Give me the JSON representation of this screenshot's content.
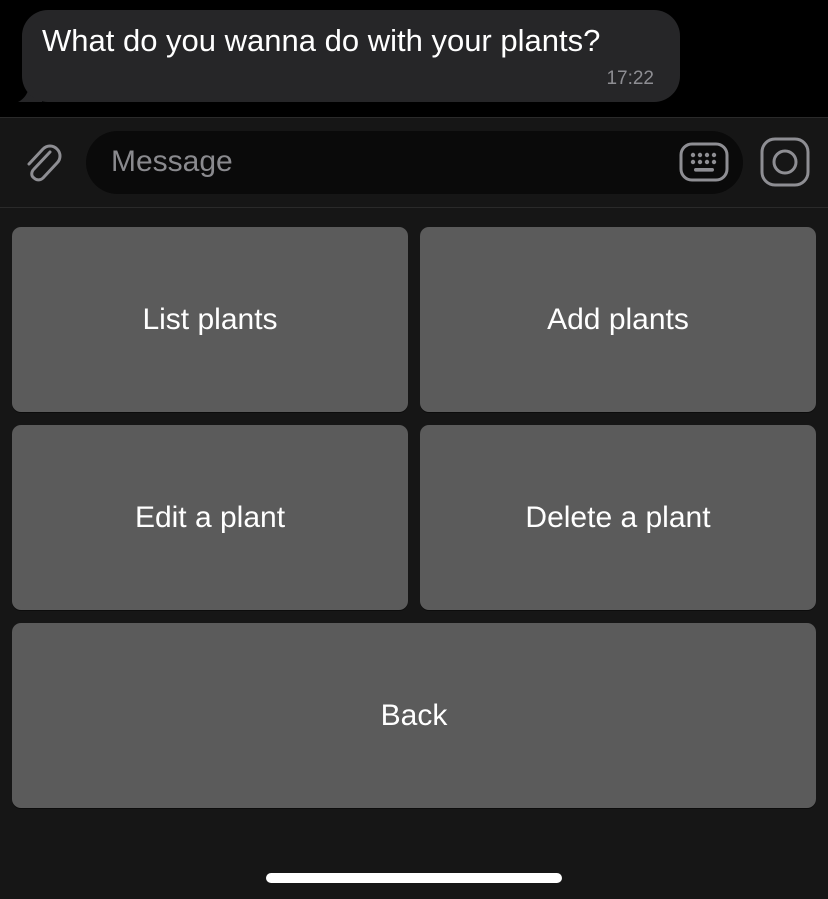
{
  "chat": {
    "message": {
      "text": "What do you wanna do with your plants?",
      "time": "17:22"
    }
  },
  "input_bar": {
    "placeholder": "Message",
    "icons": {
      "attach": "paperclip-icon",
      "keyboard": "keyboard-icon",
      "camera": "camera-icon"
    }
  },
  "reply_keyboard": {
    "buttons": [
      {
        "label": "List plants"
      },
      {
        "label": "Add plants"
      },
      {
        "label": "Edit a plant"
      },
      {
        "label": "Delete a plant"
      },
      {
        "label": "Back"
      }
    ]
  },
  "colors": {
    "background": "#000000",
    "bubble": "#262628",
    "panel": "#161616",
    "button": "#5b5b5b",
    "text": "#ffffff",
    "muted": "#8e8e93"
  }
}
